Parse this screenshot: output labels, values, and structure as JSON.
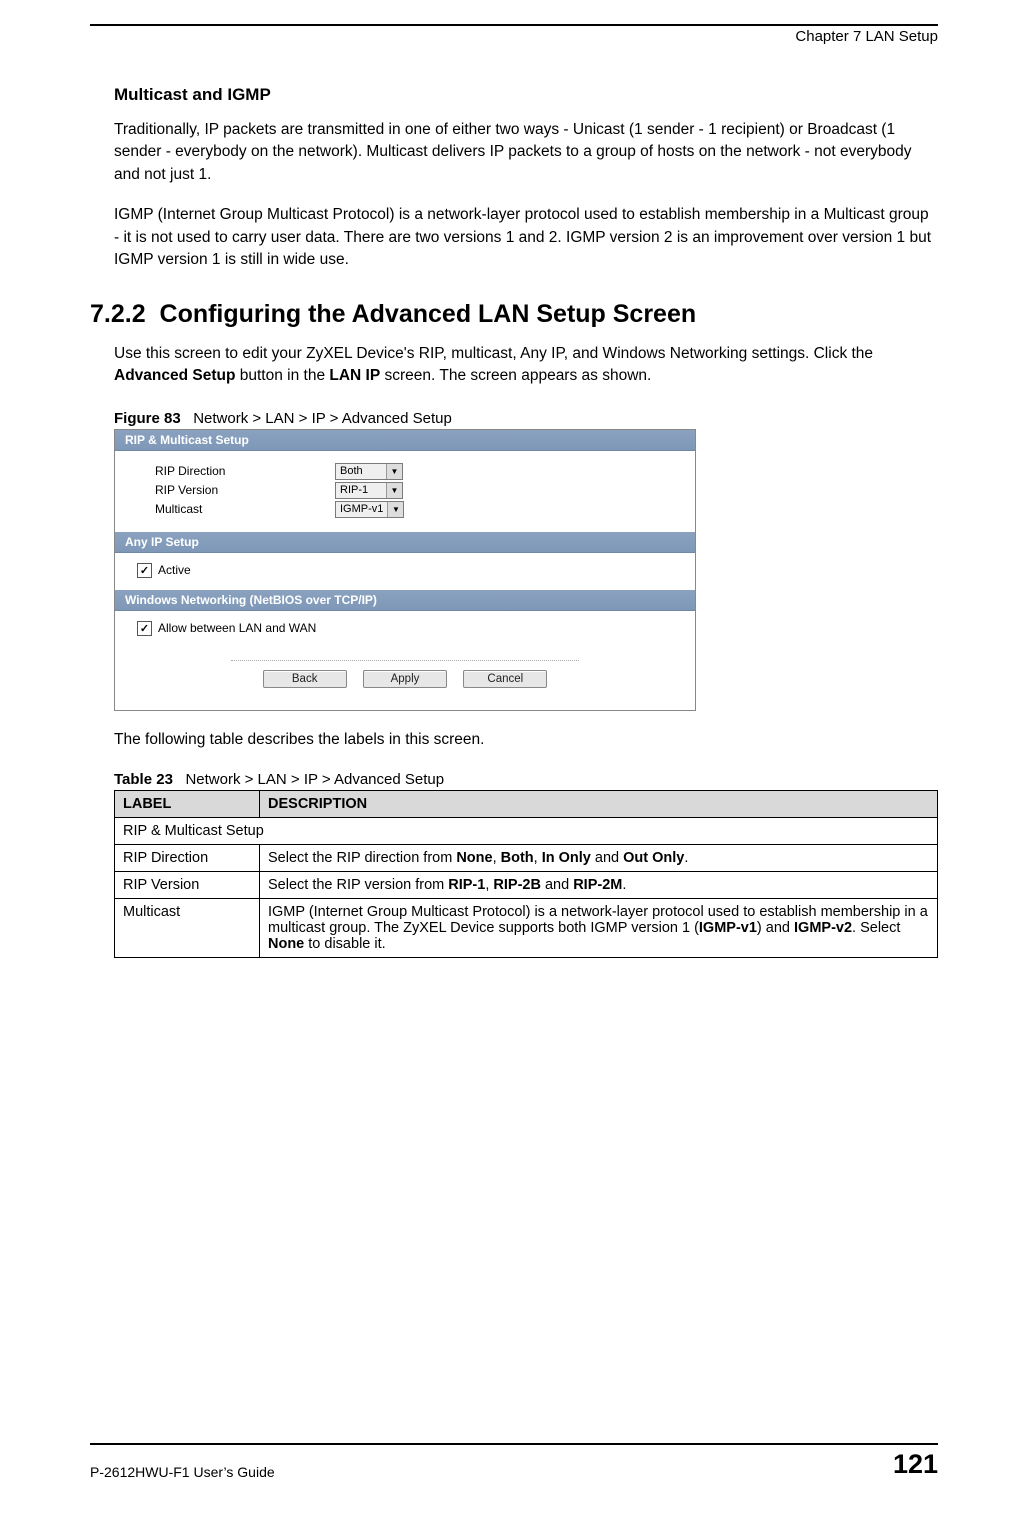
{
  "header": {
    "chapter": "Chapter 7 LAN Setup"
  },
  "subhead1": "Multicast and IGMP",
  "para1": "Traditionally, IP packets are transmitted in one of either two ways - Unicast (1 sender - 1 recipient) or Broadcast (1 sender - everybody on the network). Multicast delivers IP packets to a group of hosts on the network - not everybody and not just 1.",
  "para2": "IGMP (Internet Group Multicast Protocol) is a network-layer protocol used to establish membership in a Multicast group - it is not used to carry user data. There are two versions 1 and 2. IGMP version 2 is an improvement over version 1 but IGMP version 1 is still in wide use.",
  "h2_num": "7.2.2",
  "h2": "Configuring the Advanced LAN Setup Screen",
  "para3_a": "Use this screen to edit your ZyXEL Device's RIP, multicast, Any IP, and Windows Networking settings. Click the ",
  "para3_b_bold": "Advanced Setup",
  "para3_c": " button in the ",
  "para3_d_bold": "LAN IP",
  "para3_e": " screen. The screen appears as shown.",
  "fig": {
    "num": "Figure 83",
    "caption": "Network > LAN > IP > Advanced Setup"
  },
  "screenshot": {
    "sec1": "RIP & Multicast Setup",
    "row1_label": "RIP Direction",
    "row1_value": "Both",
    "row2_label": "RIP Version",
    "row2_value": "RIP-1",
    "row3_label": "Multicast",
    "row3_value": "IGMP-v1",
    "sec2": "Any IP Setup",
    "chk1": "Active",
    "sec3": "Windows Networking (NetBIOS over TCP/IP)",
    "chk2": "Allow between LAN and WAN",
    "btn_back": "Back",
    "btn_apply": "Apply",
    "btn_cancel": "Cancel"
  },
  "para4": "The following table describes the labels in this screen.",
  "tab": {
    "num": "Table 23",
    "caption": "Network > LAN > IP > Advanced Setup"
  },
  "table": {
    "h1": "LABEL",
    "h2": "DESCRIPTION",
    "r1c1": "RIP & Multicast Setup",
    "r2c1": "RIP Direction",
    "r2c2_a": "Select the RIP direction from ",
    "r2c2_b1": "None",
    "r2c2_c1": ", ",
    "r2c2_b2": "Both",
    "r2c2_c2": ", ",
    "r2c2_b3": "In Only",
    "r2c2_c3": " and ",
    "r2c2_b4": "Out Only",
    "r2c2_c4": ".",
    "r3c1": "RIP Version",
    "r3c2_a": "Select the RIP version from ",
    "r3c2_b1": "RIP-1",
    "r3c2_c1": ", ",
    "r3c2_b2": "RIP-2B",
    "r3c2_c2": " and ",
    "r3c2_b3": "RIP-2M",
    "r3c2_c3": ".",
    "r4c1": "Multicast",
    "r4c2_a": "IGMP (Internet Group Multicast Protocol) is a network-layer protocol used to establish membership in a multicast group. The ZyXEL Device supports both IGMP version 1 (",
    "r4c2_b1": "IGMP-v1",
    "r4c2_c1": ") and ",
    "r4c2_b2": "IGMP-v2",
    "r4c2_c2": ". Select ",
    "r4c2_b3": "None",
    "r4c2_c3": " to disable it."
  },
  "footer": {
    "guide": "P-2612HWU-F1 User’s Guide",
    "page": "121"
  }
}
